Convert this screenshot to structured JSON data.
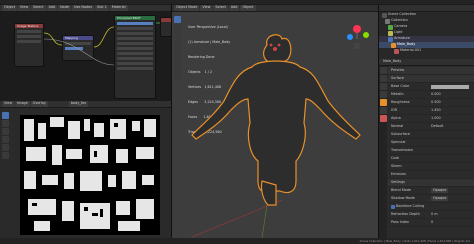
{
  "topbar": {
    "menus": [
      "File",
      "Edit",
      "Render",
      "Window",
      "Help"
    ]
  },
  "node_editor": {
    "header_items": [
      "Object",
      "View",
      "Select",
      "Add",
      "Node",
      "Use Nodes",
      "Slot 1",
      "Material"
    ],
    "nodes": [
      {
        "title": "Image Texture",
        "color": "#8b3a3a"
      },
      {
        "title": "Principled BSDF",
        "color": "#2a6b3f"
      },
      {
        "title": "Material Output",
        "color": "#8b3a3a"
      },
      {
        "title": "Mapping",
        "color": "#4a4a8b"
      }
    ]
  },
  "image_editor": {
    "header_items": [
      "View",
      "Image",
      "Overlay"
    ],
    "image_name": "body_tex"
  },
  "viewport": {
    "header_items": [
      "Object Mode",
      "View",
      "Select",
      "Add",
      "Object"
    ],
    "overlay_lines": [
      "User Perspective (Local)",
      "(1) Armature | Male_Body",
      "Rendering Done",
      "Objects    1 / 2",
      "Vertices   1,611,408",
      "Edges      3,224,300",
      "Faces      1,612,890",
      "Triangles  3,224,560"
    ],
    "accent_color": "#e8902a"
  },
  "outliner": {
    "title": "Scene Collection",
    "items": [
      "Collection",
      "Camera",
      "Light",
      "Armature",
      "Male_Body",
      "Mesh",
      "Material.001",
      "Modifiers",
      "Vertex Groups"
    ]
  },
  "properties": {
    "object_name": "Male_Body",
    "sections": [
      "Preview",
      "Surface",
      "Use Nodes",
      "Volume",
      "Displacement",
      "Settings",
      "Line Art",
      "Viewport Display",
      "Custom Properties"
    ],
    "fields": [
      {
        "label": "Base Color",
        "value": ""
      },
      {
        "label": "Metallic",
        "value": "0.000"
      },
      {
        "label": "Roughness",
        "value": "0.500"
      },
      {
        "label": "IOR",
        "value": "1.450"
      },
      {
        "label": "Alpha",
        "value": "1.000"
      },
      {
        "label": "Normal",
        "value": "Default"
      },
      {
        "label": "Subsurface",
        "value": ""
      },
      {
        "label": "Specular",
        "value": ""
      },
      {
        "label": "Transmission",
        "value": ""
      },
      {
        "label": "Coat",
        "value": ""
      },
      {
        "label": "Sheen",
        "value": ""
      },
      {
        "label": "Emission",
        "value": ""
      },
      {
        "label": "Blend Mode",
        "value": "Opaque"
      },
      {
        "label": "Shadow Mode",
        "value": "Opaque"
      },
      {
        "label": "Backface Culling",
        "value": ""
      },
      {
        "label": "Show Backface",
        "value": ""
      },
      {
        "label": "Refraction Depth",
        "value": "0 m"
      },
      {
        "label": "Pass Index",
        "value": "0"
      }
    ]
  },
  "statusbar": {
    "text": "Scene Collection | Male_Body | Verts 1,611,408 | Faces 1,612,890 | Objects 1/2"
  }
}
